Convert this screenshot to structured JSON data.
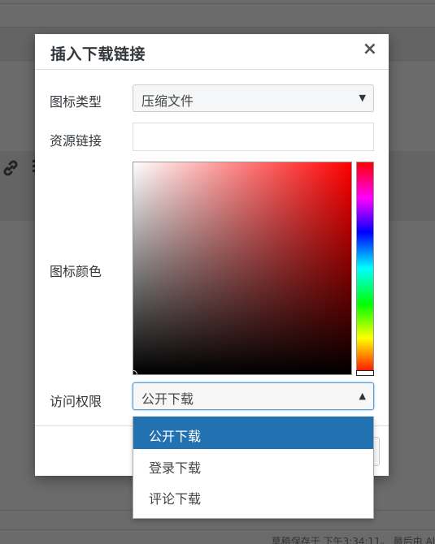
{
  "dialog": {
    "title": "插入下载链接",
    "close_glyph": "×"
  },
  "form": {
    "icon_type": {
      "label": "图标类型",
      "value": "压缩文件",
      "arrow_glyph": "▼"
    },
    "resource_link": {
      "label": "资源链接",
      "value": "",
      "placeholder": ""
    },
    "icon_color": {
      "label": "图标颜色",
      "hue_color": "#ff0000"
    },
    "access": {
      "label": "访问权限",
      "value": "公开下载",
      "arrow_glyph": "▲",
      "options": [
        "公开下载",
        "登录下载",
        "评论下载"
      ],
      "selected_option": "公开下载"
    }
  },
  "background": {
    "status_text": "草稿保存于 下午3:34:11。 最后由 Al",
    "link_icon": "link-icon"
  },
  "colors": {
    "overlay": "#6b6b6b",
    "accent": "#2271b1",
    "focus_border": "#5b9dd9"
  }
}
